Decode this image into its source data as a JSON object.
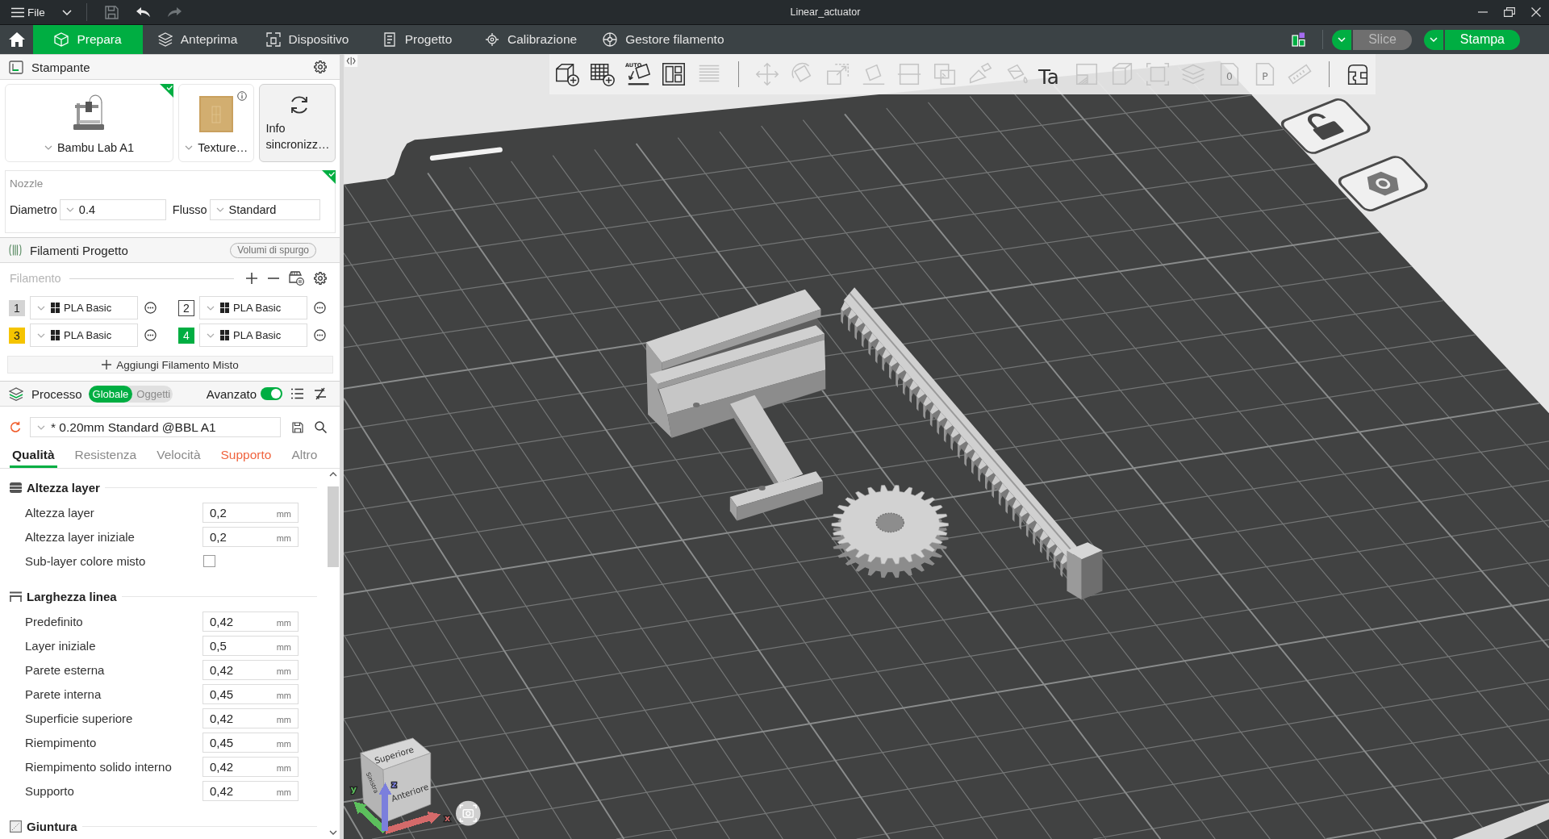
{
  "title_bar": {
    "menu": "File",
    "title": "Linear_actuator"
  },
  "nav": {
    "tabs": [
      {
        "label": "Prepara",
        "kind": "prepare",
        "selected": true
      },
      {
        "label": "Anteprima",
        "kind": "preview",
        "selected": false
      },
      {
        "label": "Dispositivo",
        "kind": "device",
        "selected": false
      },
      {
        "label": "Progetto",
        "kind": "project",
        "selected": false
      },
      {
        "label": "Calibrazione",
        "kind": "calibration",
        "selected": false
      },
      {
        "label": "Gestore filamento",
        "kind": "filament",
        "selected": false
      }
    ],
    "actions": [
      {
        "label": "Slice",
        "disabled": true
      },
      {
        "label": "Stampa",
        "disabled": false
      }
    ]
  },
  "printer": {
    "title": "Stampante",
    "model": {
      "name": "Bambu Lab A1",
      "synced": true
    },
    "plate": {
      "name": "Texture…"
    },
    "sync": {
      "label": "Info sincronizz…"
    },
    "nozzle": {
      "title": "Nozzle",
      "synced": true,
      "fields": [
        {
          "label": "Diametro",
          "value": "0.4"
        },
        {
          "label": "Flusso",
          "value": "Standard"
        }
      ]
    }
  },
  "filaments": {
    "title": "Filamenti Progetto",
    "purge": "Volumi di spurgo",
    "label": "Filamento",
    "items": [
      {
        "number": "1",
        "color": "#d4d4d4",
        "name": "PLA Basic"
      },
      {
        "number": "2",
        "color": "#ffffff",
        "name": "PLA Basic"
      },
      {
        "number": "3",
        "color": "#f5c400",
        "name": "PLA Basic"
      },
      {
        "number": "4",
        "color": "#00ae42",
        "name": "PLA Basic"
      }
    ],
    "add_mixed": "Aggiungi Filamento Misto"
  },
  "process": {
    "title": "Processo",
    "scopes": [
      {
        "label": "Globale",
        "selected": true
      },
      {
        "label": "Oggetti",
        "selected": false
      }
    ],
    "advanced": {
      "label": "Avanzato",
      "on": true
    },
    "preset": "* 0.20mm Standard @BBL A1",
    "tabs": [
      {
        "label": "Qualità",
        "selected": true,
        "modified": false
      },
      {
        "label": "Resistenza",
        "selected": false,
        "modified": false
      },
      {
        "label": "Velocità",
        "selected": false,
        "modified": false
      },
      {
        "label": "Supporto",
        "selected": false,
        "modified": true
      },
      {
        "label": "Altro",
        "selected": false,
        "modified": false
      }
    ],
    "groups": [
      {
        "title": "Altezza layer",
        "kind": "layer-height",
        "settings": [
          {
            "kind": "number",
            "label": "Altezza layer",
            "value": "0,2",
            "unit": "mm"
          },
          {
            "kind": "number",
            "label": "Altezza layer iniziale",
            "value": "0,2",
            "unit": "mm"
          },
          {
            "kind": "checkbox",
            "label": "Sub-layer colore misto",
            "checked": false
          }
        ]
      },
      {
        "title": "Larghezza linea",
        "kind": "line-width",
        "settings": [
          {
            "kind": "number",
            "label": "Predefinito",
            "value": "0,42",
            "unit": "mm"
          },
          {
            "kind": "number",
            "label": "Layer iniziale",
            "value": "0,5",
            "unit": "mm"
          },
          {
            "kind": "number",
            "label": "Parete esterna",
            "value": "0,42",
            "unit": "mm"
          },
          {
            "kind": "number",
            "label": "Parete interna",
            "value": "0,45",
            "unit": "mm"
          },
          {
            "kind": "number",
            "label": "Superficie superiore",
            "value": "0,42",
            "unit": "mm"
          },
          {
            "kind": "number",
            "label": "Riempimento",
            "value": "0,45",
            "unit": "mm"
          },
          {
            "kind": "number",
            "label": "Riempimento solido interno",
            "value": "0,42",
            "unit": "mm"
          },
          {
            "kind": "number",
            "label": "Supporto",
            "value": "0,42",
            "unit": "mm"
          }
        ]
      },
      {
        "title": "Giuntura",
        "kind": "seam"
      }
    ]
  },
  "toolbar": {
    "tools": [
      {
        "kind": "add-object",
        "disabled": false
      },
      {
        "kind": "add-plate",
        "disabled": false
      },
      {
        "kind": "auto-orient",
        "caption": "AUTO",
        "disabled": false
      },
      {
        "kind": "arrange",
        "disabled": false
      },
      {
        "kind": "lines",
        "disabled": true
      },
      {
        "kind": "separator"
      },
      {
        "kind": "move",
        "disabled": true
      },
      {
        "kind": "rotate",
        "disabled": true
      },
      {
        "kind": "scale",
        "disabled": true
      },
      {
        "kind": "lay-on-face",
        "disabled": true
      },
      {
        "kind": "cut",
        "disabled": true
      },
      {
        "kind": "boolean",
        "disabled": true
      },
      {
        "kind": "paint",
        "disabled": true
      },
      {
        "kind": "bucket",
        "disabled": true
      },
      {
        "kind": "text",
        "caption": "Ta",
        "disabled": false
      },
      {
        "kind": "hatch",
        "disabled": true
      },
      {
        "kind": "box",
        "disabled": true
      },
      {
        "kind": "fit",
        "disabled": true
      },
      {
        "kind": "stack",
        "disabled": true
      },
      {
        "kind": "page",
        "caption": "0",
        "disabled": true
      },
      {
        "kind": "page",
        "caption": "P",
        "disabled": true
      },
      {
        "kind": "ruler",
        "disabled": true
      },
      {
        "kind": "separator"
      },
      {
        "kind": "assembly",
        "disabled": false
      }
    ]
  },
  "viewport": {
    "view_cube": {
      "top": "Superiore",
      "front": "Anteriore",
      "left": "Sinistra"
    },
    "axes": [
      {
        "label": "x",
        "color": "#d46a6a"
      },
      {
        "label": "y",
        "color": "#5cbf5c"
      },
      {
        "label": "z",
        "color": "#7b7fdc"
      }
    ]
  }
}
